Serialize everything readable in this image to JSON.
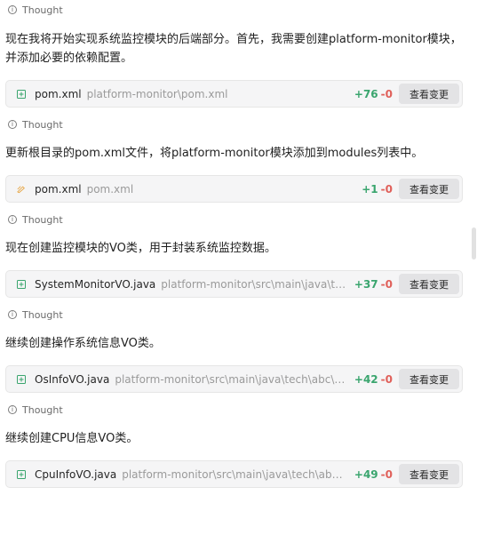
{
  "thought_label": "Thought",
  "diff_button_label": "查看变更",
  "colors": {
    "additions": "#3aa56e",
    "deletions": "#e0605a",
    "created_file_icon": "#3aa56e",
    "edited_file_icon": "#e6a23c"
  },
  "entries": [
    {
      "thought": "Thought",
      "message": "现在我将开始实现系统监控模块的后端部分。首先，我需要创建platform-monitor模块，并添加必要的依赖配置。",
      "file": {
        "icon": "file-add-icon",
        "name": "pom.xml",
        "path": "platform-monitor\\pom.xml",
        "additions": "+76",
        "deletions": "-0"
      }
    },
    {
      "thought": "Thought",
      "message": "更新根目录的pom.xml文件，将platform-monitor模块添加到modules列表中。",
      "file": {
        "icon": "file-edit-icon",
        "name": "pom.xml",
        "path": "pom.xml",
        "additions": "+1",
        "deletions": "-0"
      }
    },
    {
      "thought": "Thought",
      "message": "现在创建监控模块的VO类，用于封装系统监控数据。",
      "file": {
        "icon": "file-add-icon",
        "name": "SystemMonitorVO.java",
        "path": "platform-monitor\\src\\main\\java\\tech\\abc\\...",
        "additions": "+37",
        "deletions": "-0"
      }
    },
    {
      "thought": "Thought",
      "message": "继续创建操作系统信息VO类。",
      "file": {
        "icon": "file-add-icon",
        "name": "OsInfoVO.java",
        "path": "platform-monitor\\src\\main\\java\\tech\\abc\\platform...",
        "additions": "+42",
        "deletions": "-0"
      }
    },
    {
      "thought": "Thought",
      "message": "继续创建CPU信息VO类。",
      "file": {
        "icon": "file-add-icon",
        "name": "CpuInfoVO.java",
        "path": "platform-monitor\\src\\main\\java\\tech\\abc\\platfor...",
        "additions": "+49",
        "deletions": "-0"
      }
    }
  ]
}
